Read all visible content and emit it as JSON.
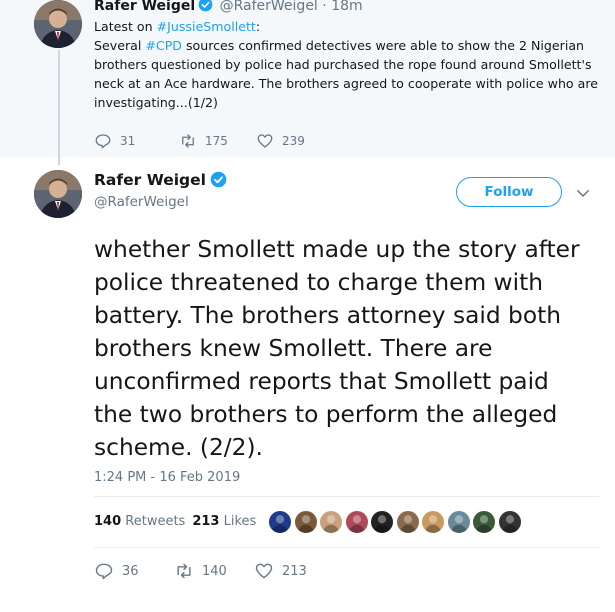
{
  "parent_tweet": {
    "name": "Rafer Weigel",
    "handle": "@RaferWeigel",
    "dot": "·",
    "time": "18m",
    "text_lines": [
      {
        "before": "Latest on ",
        "link": "#JussieSmollett",
        "after": ":"
      },
      {
        "before": "Several ",
        "link": "#CPD",
        "after": " sources confirmed detectives were able to show the 2 Nigerian"
      },
      {
        "before": "brothers questioned by police had purchased the rope found around Smollett's",
        "link": "",
        "after": ""
      },
      {
        "before": "neck at an Ace hardware. The brothers agreed to cooperate with police who are",
        "link": "",
        "after": ""
      },
      {
        "before": "investigating...(1/2)",
        "link": "",
        "after": ""
      }
    ],
    "replies": "31",
    "retweets": "175",
    "likes": "239"
  },
  "main_tweet": {
    "name": "Rafer Weigel",
    "handle": "@RaferWeigel",
    "follow_label": "Follow",
    "text_lines": [
      "whether Smollett made up the story after",
      "police threatened to charge them with",
      "battery.  The brothers attorney said both",
      "brothers knew Smollett.  There are",
      "unconfirmed reports that Smollett paid",
      "the two brothers to perform the alleged",
      "scheme. (2/2)."
    ],
    "timestamp": "1:24 PM - 16 Feb 2019",
    "retweet_count": "140",
    "retweet_label": "Retweets",
    "like_count": "213",
    "like_label": "Likes",
    "replies": "36",
    "retweets": "140",
    "likes": "213"
  },
  "colors": {
    "accent": "#1da1f2",
    "muted": "#657786",
    "parent_bg": "#f5f8fa"
  },
  "liker_avatars": [
    {
      "icon": "liker-avatar-1",
      "color": "#1f3a8a"
    },
    {
      "icon": "liker-avatar-2",
      "color": "#7a5a3a"
    },
    {
      "icon": "liker-avatar-3",
      "color": "#c7a27c"
    },
    {
      "icon": "liker-avatar-4",
      "color": "#b04a5a"
    },
    {
      "icon": "liker-avatar-5",
      "color": "#222222"
    },
    {
      "icon": "liker-avatar-6",
      "color": "#8a6a4a"
    },
    {
      "icon": "liker-avatar-7",
      "color": "#c89a60"
    },
    {
      "icon": "liker-avatar-8",
      "color": "#6a8a9a"
    },
    {
      "icon": "liker-avatar-9",
      "color": "#3a5a3a"
    },
    {
      "icon": "liker-avatar-10",
      "color": "#333333"
    }
  ]
}
